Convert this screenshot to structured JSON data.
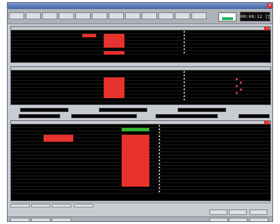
{
  "window": {
    "title": "",
    "close_glyph": "×"
  },
  "toolbar": {
    "buttons": [
      "",
      "",
      "",
      "",
      "",
      "",
      "",
      "",
      "",
      "",
      "",
      ""
    ]
  },
  "status_indicator": {
    "label": "",
    "color": "#17b35a"
  },
  "clock": {
    "text": "09:09:12 [金] 12:59"
  },
  "colors": {
    "alarm_red": "#e8322e",
    "ok_green": "#32b432",
    "panel_bg": "#000000",
    "window_bg": "#c8ccd2"
  },
  "panels": {
    "top": {
      "close_label": "×",
      "rows": 7
    },
    "middle": {
      "rows": 9
    },
    "bottom": {
      "close_label": "×",
      "rows": 20
    }
  },
  "filter_labels": {
    "row1": [
      "",
      "",
      "",
      ""
    ],
    "row2": [
      "",
      "",
      "",
      ""
    ]
  },
  "tabs": [
    "",
    "",
    "",
    ""
  ],
  "controls": [
    "",
    "",
    ""
  ],
  "bottom_buttons": {
    "left": [
      "",
      "",
      ""
    ],
    "right": [
      "",
      "",
      ""
    ]
  }
}
